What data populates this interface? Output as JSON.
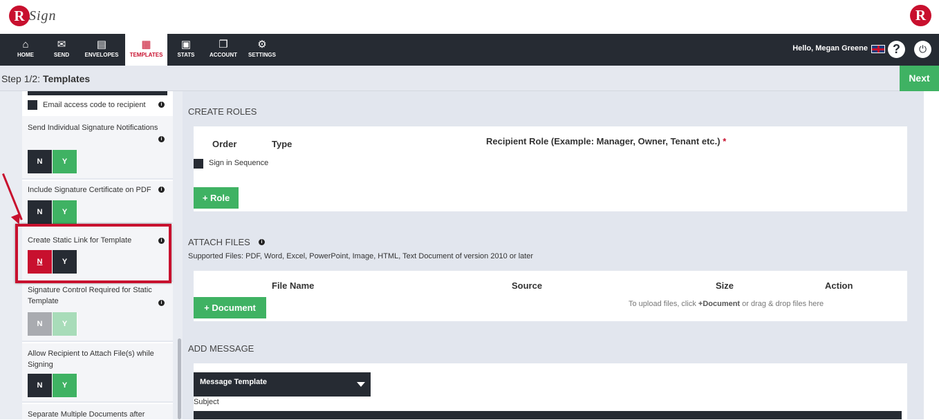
{
  "brand": {
    "logo_letter": "R",
    "logo_text": "Sign",
    "accent": "#c8102e",
    "green": "#3fb263",
    "dark": "#262b33"
  },
  "nav": {
    "items": [
      {
        "label": "HOME",
        "icon": "home-icon",
        "glyph": "⌂"
      },
      {
        "label": "SEND",
        "icon": "envelope-icon",
        "glyph": "✉"
      },
      {
        "label": "ENVELOPES",
        "icon": "inbox-icon",
        "glyph": "▤"
      },
      {
        "label": "TEMPLATES",
        "icon": "templates-icon",
        "glyph": "▦",
        "active": true
      },
      {
        "label": "STATS",
        "icon": "briefcase-icon",
        "glyph": "▣"
      },
      {
        "label": "ACCOUNT",
        "icon": "files-icon",
        "glyph": "❐"
      },
      {
        "label": "SETTINGS",
        "icon": "gear-icon",
        "glyph": "⚙"
      }
    ],
    "greeting": "Hello, Megan Greene",
    "help": "?",
    "power": "⏻"
  },
  "step": {
    "prefix": "Step 1/2: ",
    "title": "Templates",
    "next_label": "Next"
  },
  "sidebar": {
    "email_access": "Email access code to recipient",
    "send_individual": "Send Individual Signature Notifications",
    "include_cert": "Include Signature Certificate on PDF",
    "static_link": "Create Static Link for Template",
    "signature_control": "Signature Control Required for Static Template",
    "allow_attach": "Allow Recipient to Attach File(s) while Signing",
    "separate_docs": "Separate Multiple Documents after",
    "n": "N",
    "y": "Y",
    "info": "i"
  },
  "roles": {
    "title": "CREATE ROLES",
    "order": "Order",
    "type": "Type",
    "recipient_role": "Recipient Role (Example: Manager, Owner, Tenant etc.)",
    "required": "*",
    "sign_sequence": "Sign in Sequence",
    "add_role": "+ Role"
  },
  "files": {
    "title": "ATTACH FILES",
    "supported": "Supported Files: PDF, Word, Excel, PowerPoint, Image, HTML, Text Document of version 2010 or later",
    "file_name": "File Name",
    "source": "Source",
    "size": "Size",
    "action": "Action",
    "add_document": "+ Document",
    "hint_pre": "To upload files, click ",
    "hint_bold": "+Document",
    "hint_post": " or drag & drop files here"
  },
  "message": {
    "title": "ADD MESSAGE",
    "template_label": "Message Template",
    "subject": "Subject"
  }
}
